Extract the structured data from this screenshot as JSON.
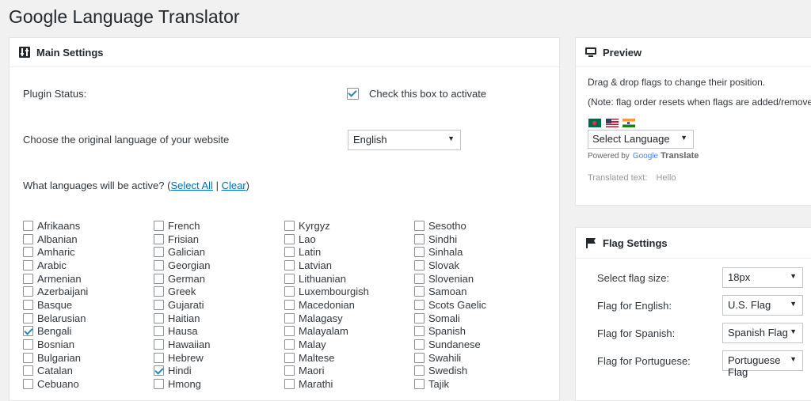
{
  "page_title": "Google Language Translator",
  "main": {
    "title": "Main Settings",
    "plugin_status_label": "Plugin Status:",
    "activate_label": "Check this box to activate",
    "original_lang_label": "Choose the original language of your website",
    "original_lang_value": "English",
    "active_langs_label": "What languages will be active?",
    "select_all": "Select All",
    "clear": "Clear",
    "open_paren": "(",
    "pipe": " | ",
    "close_paren": ")",
    "languages": [
      [
        "Afrikaans",
        "Albanian",
        "Amharic",
        "Arabic",
        "Armenian",
        "Azerbaijani",
        "Basque",
        "Belarusian",
        "Bengali",
        "Bosnian",
        "Bulgarian",
        "Catalan",
        "Cebuano"
      ],
      [
        "French",
        "Frisian",
        "Galician",
        "Georgian",
        "German",
        "Greek",
        "Gujarati",
        "Haitian",
        "Hausa",
        "Hawaiian",
        "Hebrew",
        "Hindi",
        "Hmong"
      ],
      [
        "Kyrgyz",
        "Lao",
        "Latin",
        "Latvian",
        "Lithuanian",
        "Luxembourgish",
        "Macedonian",
        "Malagasy",
        "Malayalam",
        "Malay",
        "Maltese",
        "Maori",
        "Marathi"
      ],
      [
        "Sesotho",
        "Sindhi",
        "Sinhala",
        "Slovak",
        "Slovenian",
        "Samoan",
        "Scots Gaelic",
        "Somali",
        "Spanish",
        "Sundanese",
        "Swahili",
        "Swedish",
        "Tajik"
      ]
    ],
    "checked_languages": [
      "Bengali",
      "Hindi"
    ]
  },
  "preview": {
    "title": "Preview",
    "drag_text": "Drag & drop flags to change their position.",
    "note_text": "(Note: flag order resets when flags are added/remove",
    "select_language": "Select Language",
    "powered_by": "Powered by",
    "google": "Google",
    "translate": "Translate",
    "translated_label": "Translated text:",
    "translated_value": "Hello"
  },
  "flag_settings": {
    "title": "Flag Settings",
    "rows": [
      {
        "label": "Select flag size:",
        "value": "18px"
      },
      {
        "label": "Flag for English:",
        "value": "U.S. Flag"
      },
      {
        "label": "Flag for Spanish:",
        "value": "Spanish Flag"
      },
      {
        "label": "Flag for Portuguese:",
        "value": "Portuguese Flag"
      }
    ]
  },
  "icons": {
    "settings": "sliders-icon",
    "preview": "monitor-icon",
    "flag": "flag-icon",
    "dropdown": "caret-down-icon"
  },
  "colors": {
    "link": "#0073aa",
    "check": "#1e8cbe",
    "background": "#f1f1f1"
  }
}
